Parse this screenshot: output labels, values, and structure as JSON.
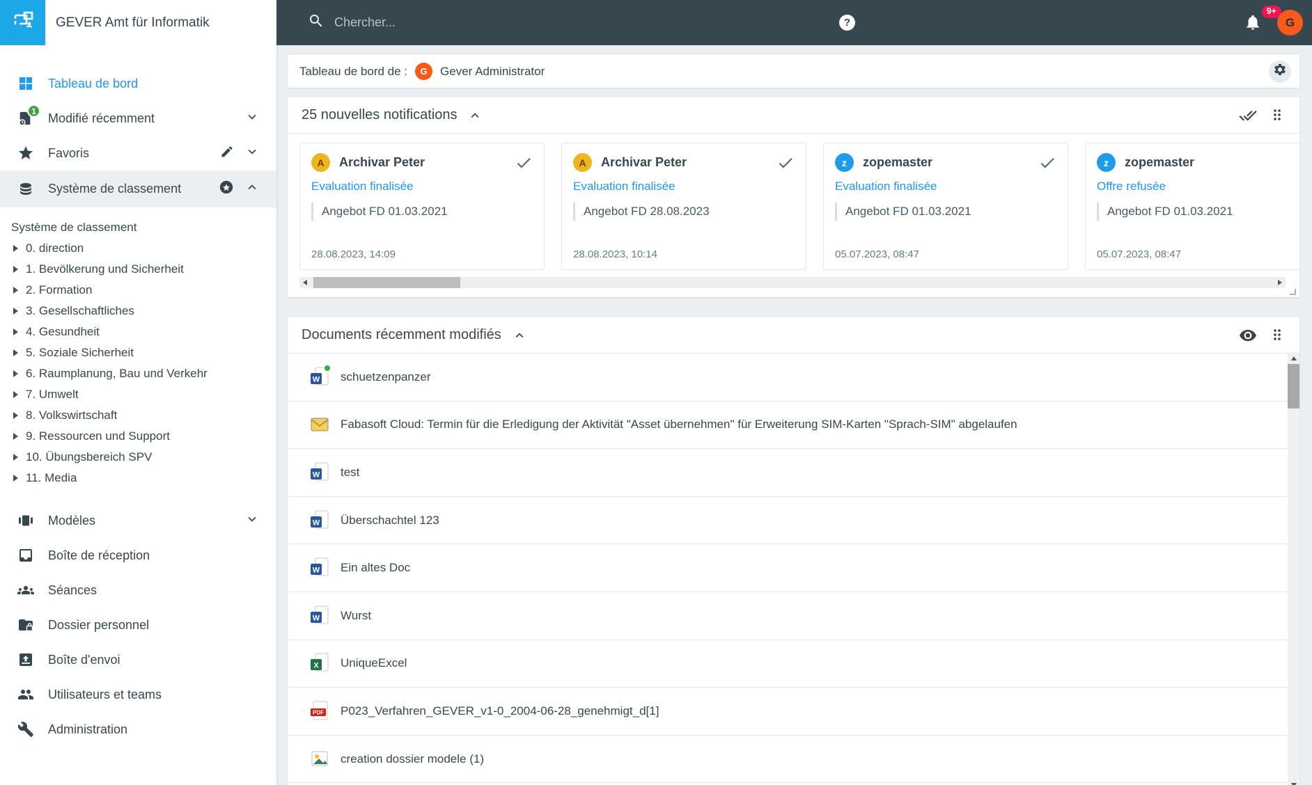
{
  "topbar": {
    "app_title": "GEVER Amt für Informatik",
    "search_placeholder": "Chercher...",
    "help_label": "?",
    "notification_count": "9+",
    "avatar_initial": "G"
  },
  "sidebar": {
    "nav_top": [
      {
        "label": "Tableau de bord",
        "icon": "dashboard-icon",
        "active": true
      },
      {
        "label": "Modifié récemment",
        "icon": "recent-doc-icon",
        "badge": "1",
        "chevron": "down"
      },
      {
        "label": "Favoris",
        "icon": "star-icon",
        "chevron": "down"
      },
      {
        "label": "Système de classement",
        "icon": "database-icon",
        "selected": true,
        "chevron": "up"
      }
    ],
    "tree": {
      "root": "Système de classement",
      "items": [
        "0. direction",
        "1. Bevölkerung und Sicherheit",
        "2. Formation",
        "3. Gesellschaftliches",
        "4. Gesundheit",
        "5. Soziale Sicherheit",
        "6. Raumplanung, Bau und Verkehr",
        "7. Umwelt",
        "8. Volkswirtschaft",
        "9. Ressourcen und Support",
        "10. Übungsbereich SPV",
        "11. Media"
      ]
    },
    "nav_bottom": [
      {
        "label": "Modèles",
        "icon": "templates-icon",
        "chevron": "down"
      },
      {
        "label": "Boîte de réception",
        "icon": "inbox-icon"
      },
      {
        "label": "Séances",
        "icon": "meetings-icon"
      },
      {
        "label": "Dossier personnel",
        "icon": "personal-folder-icon"
      },
      {
        "label": "Boîte d'envoi",
        "icon": "outbox-icon"
      },
      {
        "label": "Utilisateurs et teams",
        "icon": "users-icon"
      },
      {
        "label": "Administration",
        "icon": "wrench-icon"
      }
    ]
  },
  "dashboard": {
    "title_prefix": "Tableau de bord de :",
    "user_name": "Gever Administrator",
    "avatar_initial": "G"
  },
  "notifications": {
    "title": "25 nouvelles notifications",
    "cards": [
      {
        "avatar_initial": "A",
        "name": "Archivar Peter",
        "action": "Evaluation finalisée",
        "subject": "Angebot FD 01.03.2021",
        "timestamp": "28.08.2023, 14:09"
      },
      {
        "avatar_initial": "A",
        "name": "Archivar Peter",
        "action": "Evaluation finalisée",
        "subject": "Angebot FD 28.08.2023",
        "timestamp": "28.08.2023, 10:14"
      },
      {
        "avatar_initial": "z",
        "name": "zopemaster",
        "action": "Evaluation finalisée",
        "subject": "Angebot FD 01.03.2021",
        "timestamp": "05.07.2023, 08:47"
      },
      {
        "avatar_initial": "z",
        "name": "zopemaster",
        "action": "Offre refusée",
        "subject": "Angebot FD 01.03.2021",
        "timestamp": "05.07.2023, 08:47"
      }
    ]
  },
  "documents": {
    "title": "Documents récemment modifiés",
    "items": [
      {
        "title": "schuetzenpanzer",
        "icon": "word-file-icon",
        "status_dot": "green"
      },
      {
        "title": "Fabasoft Cloud: Termin für die Erledigung der Aktivität \"Asset übernehmen\" für Erweiterung SIM-Karten \"Sprach-SIM\" abgelaufen",
        "icon": "email-file-icon"
      },
      {
        "title": "test",
        "icon": "word-file-icon"
      },
      {
        "title": "Überschachtel 123",
        "icon": "word-file-icon"
      },
      {
        "title": "Ein altes Doc",
        "icon": "word-file-icon"
      },
      {
        "title": "Wurst",
        "icon": "word-file-icon"
      },
      {
        "title": "UniqueExcel",
        "icon": "excel-file-icon"
      },
      {
        "title": "P023_Verfahren_GEVER_v1-0_2004-06-28_genehmigt_d[1]",
        "icon": "pdf-file-icon"
      },
      {
        "title": "creation dossier modele (1)",
        "icon": "image-file-icon"
      }
    ]
  },
  "colors": {
    "topbar": "#37474f",
    "accent_blue": "#2196f3",
    "logo_blue": "#1ba7e8",
    "avatar_orange": "#f85a19",
    "badge_red": "#ef1550",
    "badge_green": "#43a047",
    "amber_avatar": "#f0b41e",
    "blue_avatar": "#1d9de9",
    "background": "#eceff1"
  }
}
